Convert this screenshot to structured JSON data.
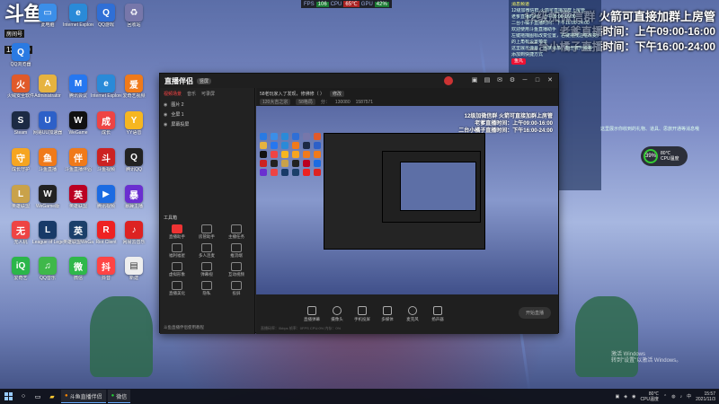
{
  "logo": {
    "mark": "斗鱼",
    "room_label": "房间号",
    "room_number": "130080"
  },
  "monitor": {
    "fps_label": "FPS",
    "fps": "106",
    "cpu_label": "CPU",
    "cpu": "65℃",
    "gpu_label": "GPU",
    "gpu": "42%"
  },
  "overlay": {
    "line1": "12级加微信群 火箭可直接加群上房管",
    "line2": "老爹直播时间：上午09:00-16:00",
    "line3": "二台小橘子直播时间：下午16:00-24:00"
  },
  "chat": {
    "title": "消息频道",
    "lines": [
      "12级加微信群 火箭可直接加群上房管",
      "老爹直播时间：上午09:00-16:00",
      "二台小橘子直播时间：下午16:00-24:00",
      "欢迎使用斗鱼直播助手",
      "左键拖拽图标改变位置，右键拖拽边框改变大小",
      "的上角有设置菜单",
      "这里展示弹幕，思旅消息，粉丝牌升级等",
      "添加到快捷方式"
    ],
    "badge": "鱼丸",
    "side_info": "这里展示你收到的礼物、道具、思旅开通等消息哦"
  },
  "perf": {
    "percent": "39%",
    "temp1": "80℃",
    "temp2": "CPU温度"
  },
  "desktop_icons": [
    {
      "label": "QQ浏览器",
      "color": "#2a7ae2",
      "glyph": "Q"
    },
    {
      "label": "此电脑",
      "color": "#3b8ee8",
      "glyph": "▭"
    },
    {
      "label": "Internet Explorer",
      "color": "#2a8ad8",
      "glyph": "e"
    },
    {
      "label": "QQ游戏",
      "color": "#2f6fd6",
      "glyph": "Q"
    },
    {
      "label": "回收站",
      "color": "#77a",
      "glyph": "♻"
    },
    {
      "label": "火绒安全软件",
      "color": "#e05a2a",
      "glyph": "火"
    },
    {
      "label": "Administrator",
      "color": "#e6b340",
      "glyph": "A"
    },
    {
      "label": "腾讯会议",
      "color": "#2677f0",
      "glyph": "M"
    },
    {
      "label": "Internet Explorer",
      "color": "#2a8ad8",
      "glyph": "e"
    },
    {
      "label": "爱奇艺视频",
      "color": "#f07a1a",
      "glyph": "爱"
    },
    {
      "label": "Steam",
      "color": "#1c2a44",
      "glyph": "S"
    },
    {
      "label": "网易UU加速器",
      "color": "#2d60c8",
      "glyph": "U"
    },
    {
      "label": "WeGame",
      "color": "#111",
      "glyph": "W"
    },
    {
      "label": "成长",
      "color": "#e44",
      "glyph": "成"
    },
    {
      "label": "YY语音",
      "color": "#f6b620",
      "glyph": "Y"
    },
    {
      "label": "成长守护",
      "color": "#f6a520",
      "glyph": "守"
    },
    {
      "label": "斗鱼直播",
      "color": "#f07a1a",
      "glyph": "鱼"
    },
    {
      "label": "斗鱼直播伴侣",
      "color": "#f07a1a",
      "glyph": "伴"
    },
    {
      "label": "斗鱼视频",
      "color": "#c22",
      "glyph": "斗"
    },
    {
      "label": "腾讯QQ",
      "color": "#222",
      "glyph": "Q"
    },
    {
      "label": "英雄联盟",
      "color": "#c9a24a",
      "glyph": "L"
    },
    {
      "label": "WeGame版",
      "color": "#222",
      "glyph": "W"
    },
    {
      "label": "英雄联盟",
      "color": "#b02",
      "glyph": "英"
    },
    {
      "label": "腾讯视频",
      "color": "#1c6be2",
      "glyph": "▶"
    },
    {
      "label": "暴躁主播",
      "color": "#6a2fd0",
      "glyph": "暴"
    },
    {
      "label": "无人机",
      "color": "#e44",
      "glyph": "无"
    },
    {
      "label": "League of Legends",
      "color": "#183a68",
      "glyph": "L"
    },
    {
      "label": "英雄联盟WeGame",
      "color": "#1b3f6a",
      "glyph": "英"
    },
    {
      "label": "Riot Client",
      "color": "#e22",
      "glyph": "R"
    },
    {
      "label": "网易云音乐",
      "color": "#d22",
      "glyph": "♪"
    },
    {
      "label": "爱奇艺",
      "color": "#2bb64a",
      "glyph": "iQ"
    },
    {
      "label": "QQ音乐",
      "color": "#3fb84a",
      "glyph": "♫"
    },
    {
      "label": "微信",
      "color": "#2fb84a",
      "glyph": "微"
    },
    {
      "label": "抖音",
      "color": "#f44",
      "glyph": "抖"
    },
    {
      "label": "新建",
      "color": "#eee",
      "glyph": "▤"
    }
  ],
  "app": {
    "logo": "直播伴侣",
    "mode": "竖屏",
    "tabs": [
      "视频场景",
      "音乐",
      "可录屏"
    ],
    "scenes": [
      "图片 2",
      "全屏 1",
      "屏幕投屏"
    ],
    "stream_info": "58老玩家入了发现，修佛修（ ）",
    "stream_btn": "修改",
    "stream_sub": [
      "120大吉之宗",
      "58格局",
      "分：",
      "130080",
      "1587571"
    ],
    "tools_title": "工具箱",
    "tools": [
      "直播助手",
      "房管助手",
      "主播任务",
      "福利福星",
      "多人连麦",
      "推流端",
      "虚拟形象",
      "弹幕视",
      "互动视频",
      "直播美化",
      "隐私",
      "投屏"
    ],
    "controls": [
      "直播弹幕",
      "摄像头",
      "手机投屏",
      "多媒体",
      "麦克风",
      "扬声器"
    ],
    "start_label": "开始直播",
    "footer": "斗鱼直播伴侣使用教程",
    "status": "直播码率：0kbps  帧率：0FPS  CPU:0%  内存：0%"
  },
  "preview_overlay": {
    "l1": "12级加微信群 火箭可直接加群上房管",
    "l2": "老爹直播时间：上午09:00-16:00",
    "l3": "二台小橘子直播时间：下午16:00-24:00"
  },
  "activation": {
    "l1": "激活 Windows",
    "l2": "转到\"设置\"以激活 Windows。"
  },
  "taskbar": {
    "apps": [
      "斗鱼直播伴侣",
      "微信"
    ],
    "temp": "80℃",
    "temp_label": "CPU温度",
    "time": "15:57",
    "date": "2021/11/3"
  }
}
